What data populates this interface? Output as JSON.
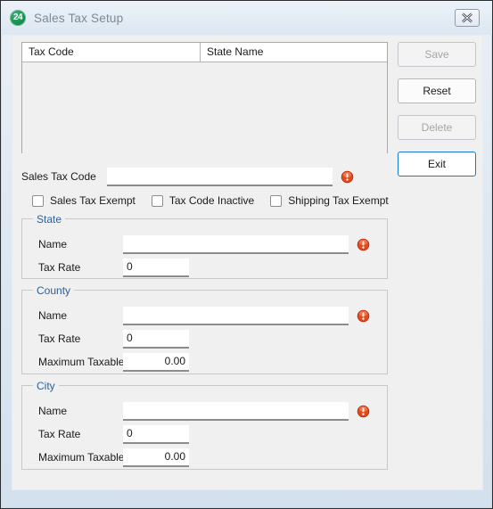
{
  "window": {
    "title": "Sales Tax Setup",
    "app_icon_label": "24",
    "close_icon": "close-icon"
  },
  "grid": {
    "columns": [
      "Tax Code",
      "State Name"
    ],
    "rows": []
  },
  "buttons": [
    {
      "label": "Save",
      "name": "save-button",
      "state": "disabled"
    },
    {
      "label": "Reset",
      "name": "reset-button",
      "state": "enabled"
    },
    {
      "label": "Delete",
      "name": "delete-button",
      "state": "disabled"
    },
    {
      "label": "Exit",
      "name": "exit-button",
      "state": "focused"
    }
  ],
  "sales_tax_code": {
    "label": "Sales Tax Code",
    "value": "",
    "placeholder": "",
    "error_icon": "error-icon"
  },
  "checkboxes": [
    {
      "label": "Sales Tax Exempt",
      "checked": false
    },
    {
      "label": "Tax Code Inactive",
      "checked": false
    },
    {
      "label": "Shipping Tax Exempt",
      "checked": false
    }
  ],
  "groups": {
    "state": {
      "legend": "State",
      "name_label": "Name",
      "name_value": "",
      "rate_label": "Tax Rate",
      "rate_value": "0"
    },
    "county": {
      "legend": "County",
      "name_label": "Name",
      "name_value": "",
      "rate_label": "Tax Rate",
      "rate_value": "0",
      "max_label": "Maximum Taxable",
      "max_value": "0.00"
    },
    "city": {
      "legend": "City",
      "name_label": "Name",
      "name_value": "",
      "rate_label": "Tax Rate",
      "rate_value": "0",
      "max_label": "Maximum Taxable",
      "max_value": "0.00"
    }
  },
  "colors": {
    "legend_blue": "#2a6099",
    "focus_blue": "#1779d0",
    "error_red": "#d63c14",
    "icon_green": "#17924f"
  }
}
